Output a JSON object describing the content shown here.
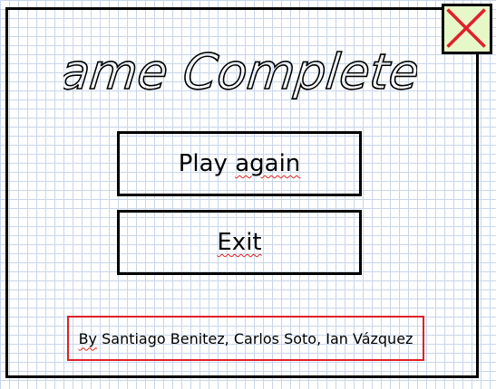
{
  "title": "Game Completed",
  "buttons": {
    "play_again_word1": "Play",
    "play_again_word2": "again",
    "exit": "Exit"
  },
  "credits": {
    "prefix": "By",
    "names": " Santiago Benitez, Carlos Soto, Ian Vázquez"
  },
  "icons": {
    "close": "close-icon"
  },
  "colors": {
    "close_bg": "#e6f7c8",
    "close_x": "#e0202a",
    "credits_border": "#e0202a",
    "grid": "#c9d6ea"
  }
}
